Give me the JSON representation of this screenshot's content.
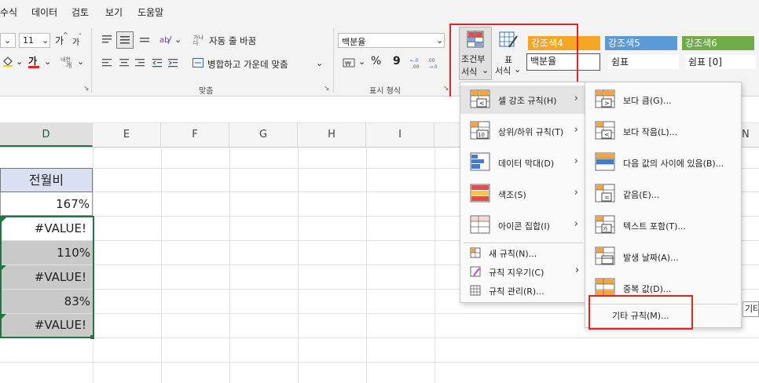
{
  "menu_bar": {
    "items": [
      "수식",
      "데이터",
      "검토",
      "보기",
      "도움말"
    ]
  },
  "ribbon": {
    "font_size": "11",
    "font_grow": "가",
    "font_shrink": "가",
    "font_color_glyph": "가",
    "wrap_text": "자동 줄 바꿈",
    "merge_center": "병합하고 가운데 맞춤",
    "number_format": "백분율",
    "percent_symbol": "%",
    "comma_symbol": "9",
    "group_alignment": "맞춤",
    "group_number": "표시 형식",
    "cond_format": {
      "line1": "조건부",
      "line2": "서식"
    },
    "table_format": {
      "line1": "표",
      "line2": "서식"
    },
    "styles": [
      {
        "label": "강조색4",
        "bg": "#f5a623",
        "fg": "#ffffff"
      },
      {
        "label": "강조색5",
        "bg": "#5b9bd5",
        "fg": "#ffffff"
      },
      {
        "label": "강조색6",
        "bg": "#70ad47",
        "fg": "#ffffff"
      },
      {
        "label": "백분율",
        "bg": "#ffffff",
        "fg": "#222222"
      },
      {
        "label": "쉼표",
        "bg": "#ffffff",
        "fg": "#222222"
      },
      {
        "label": "쉼표 [0]",
        "bg": "#ffffff",
        "fg": "#222222"
      }
    ]
  },
  "columns": [
    "D",
    "E",
    "F",
    "G",
    "H",
    "I",
    "N"
  ],
  "sheet": {
    "header": "전월비",
    "cells": [
      "167%",
      "#VALUE!",
      "110%",
      "#VALUE!",
      "83%",
      "#VALUE!"
    ]
  },
  "cf_menu": {
    "items": [
      {
        "label": "셀 강조 규칙(H)",
        "icon": "highlight-cells-icon"
      },
      {
        "label": "상위/하위 규칙(T)",
        "icon": "top-bottom-icon"
      },
      {
        "label": "데이터 막대(D)",
        "icon": "data-bars-icon"
      },
      {
        "label": "색조(S)",
        "icon": "color-scales-icon"
      },
      {
        "label": "아이콘 집합(I)",
        "icon": "icon-sets-icon"
      }
    ],
    "small_items": [
      {
        "label": "새 규칙(N)...",
        "icon": "new-rule-icon"
      },
      {
        "label": "규칙 지우기(C)",
        "icon": "clear-rules-icon"
      },
      {
        "label": "규칙 관리(R)...",
        "icon": "manage-rules-icon"
      }
    ]
  },
  "submenu": {
    "items": [
      {
        "label": "보다 큼(G)...",
        "icon": "greater-than-icon"
      },
      {
        "label": "보다 작음(L)...",
        "icon": "less-than-icon"
      },
      {
        "label": "다음 값의 사이에 있음(B)...",
        "icon": "between-icon"
      },
      {
        "label": "같음(E)...",
        "icon": "equal-icon"
      },
      {
        "label": "텍스트 포함(T)...",
        "icon": "text-contains-icon"
      },
      {
        "label": "발생 날짜(A)...",
        "icon": "date-occurring-icon"
      },
      {
        "label": "중복 값(D)...",
        "icon": "duplicate-values-icon"
      }
    ],
    "more_rules": "기타 규칙(M)...",
    "tooltip": "기타"
  },
  "colors": {
    "accent_red": "#e32222",
    "selection_green": "#217346",
    "header_blue": "#d9e1f2"
  }
}
